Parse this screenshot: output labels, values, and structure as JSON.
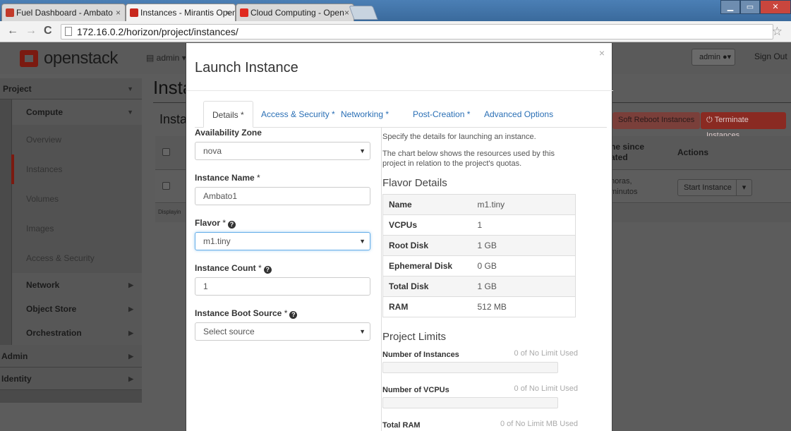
{
  "browser": {
    "tabs": [
      {
        "title": "Fuel Dashboard - Ambato",
        "close": "×"
      },
      {
        "title": "Instances - Mirantis Open",
        "close": "×"
      },
      {
        "title": "Cloud Computing - Open",
        "close": "×"
      }
    ],
    "url": "172.16.0.2/horizon/project/instances/",
    "nav": {
      "back": "←",
      "forward": "→",
      "reload": "C"
    },
    "star": "☆",
    "window_buttons": {
      "minimize": "▁",
      "restore": "▭",
      "close": "✕"
    }
  },
  "header": {
    "logo": "openstack",
    "project_selector": "admin",
    "user_menu": "admin",
    "sign_out": "Sign Out"
  },
  "sidebar": {
    "project": "Project",
    "compute": "Compute",
    "items": [
      "Overview",
      "Instances",
      "Volumes",
      "Images",
      "Access & Security"
    ],
    "network": "Network",
    "object_store": "Object Store",
    "orchestration": "Orchestration",
    "admin": "Admin",
    "identity": "Identity"
  },
  "main": {
    "title": "Insta",
    "subtitle": "Insta",
    "soft_reboot": "Soft Reboot Instances",
    "terminate": "Terminate Instances",
    "col_time": "ne since ated",
    "col_actions": "Actions",
    "row_time": "horas, minutos",
    "row_action": "Start Instance",
    "footer": "Displayin"
  },
  "modal": {
    "title": "Launch Instance",
    "close": "×",
    "tabs": [
      "Details *",
      "Access & Security *",
      "Networking *",
      "Post-Creation *",
      "Advanced Options"
    ],
    "form": {
      "availability_zone_label": "Availability Zone",
      "availability_zone_value": "nova",
      "instance_name_label": "Instance Name",
      "instance_name_value": "Ambato1",
      "flavor_label": "Flavor",
      "flavor_value": "m1.tiny",
      "instance_count_label": "Instance Count",
      "instance_count_value": "1",
      "boot_source_label": "Instance Boot Source",
      "boot_source_value": "Select source",
      "required_mark": "*"
    },
    "help": {
      "line1": "Specify the details for launching an instance.",
      "line2": "The chart below shows the resources used by this project in relation to the project's quotas."
    },
    "flavor_details": {
      "title": "Flavor Details",
      "rows": [
        {
          "k": "Name",
          "v": "m1.tiny"
        },
        {
          "k": "VCPUs",
          "v": "1"
        },
        {
          "k": "Root Disk",
          "v": "1 GB"
        },
        {
          "k": "Ephemeral Disk",
          "v": "0 GB"
        },
        {
          "k": "Total Disk",
          "v": "1 GB"
        },
        {
          "k": "RAM",
          "v": "512 MB"
        }
      ]
    },
    "project_limits": {
      "title": "Project Limits",
      "items": [
        {
          "name": "Number of Instances",
          "used": "0 of No Limit Used"
        },
        {
          "name": "Number of VCPUs",
          "used": "0 of No Limit Used"
        },
        {
          "name": "Total RAM",
          "used": "0 of No Limit MB Used"
        }
      ]
    }
  }
}
